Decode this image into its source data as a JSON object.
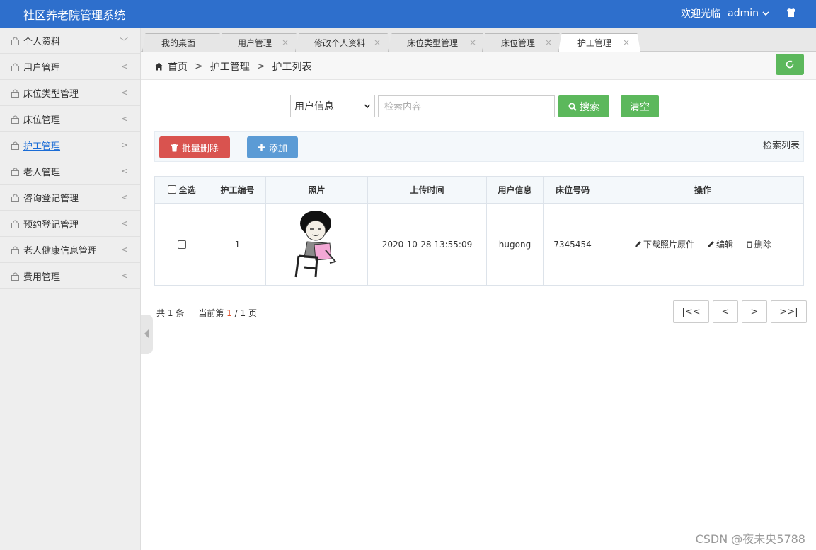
{
  "header": {
    "title": "社区养老院管理系统",
    "welcome": "欢迎光临",
    "username": "admin"
  },
  "sidebar": {
    "items": [
      {
        "label": "个人资料",
        "chevron": "﹀"
      },
      {
        "label": "用户管理",
        "chevron": "<"
      },
      {
        "label": "床位类型管理",
        "chevron": "<"
      },
      {
        "label": "床位管理",
        "chevron": "<"
      },
      {
        "label": "护工管理",
        "chevron": ">"
      },
      {
        "label": "老人管理",
        "chevron": "<"
      },
      {
        "label": "咨询登记管理",
        "chevron": "<"
      },
      {
        "label": "预约登记管理",
        "chevron": "<"
      },
      {
        "label": "老人健康信息管理",
        "chevron": "<"
      },
      {
        "label": "费用管理",
        "chevron": "<"
      }
    ]
  },
  "tabs": [
    {
      "label": "我的桌面",
      "close": ""
    },
    {
      "label": "用户管理",
      "close": "×"
    },
    {
      "label": "修改个人资料",
      "close": "×"
    },
    {
      "label": "床位类型管理",
      "close": "×"
    },
    {
      "label": "床位管理",
      "close": "×"
    },
    {
      "label": "护工管理",
      "close": "×"
    }
  ],
  "breadcrumb": {
    "home": "首页",
    "sep": ">",
    "level1": "护工管理",
    "level2": "护工列表"
  },
  "search": {
    "select_value": "用户信息",
    "placeholder": "检索内容",
    "search_label": "搜索",
    "clear_label": "清空"
  },
  "actions": {
    "batch_delete": "批量删除",
    "add": "添加",
    "list_title": "检索列表"
  },
  "table": {
    "headers": {
      "select_all": "全选",
      "id": "护工编号",
      "photo": "照片",
      "upload_time": "上传时间",
      "user_info": "用户信息",
      "bed_no": "床位号码",
      "ops": "操作"
    },
    "rows": [
      {
        "id": "1",
        "upload_time": "2020-10-28 13:55:09",
        "user_info": "hugong",
        "bed_no": "7345454",
        "download": "下载照片原件",
        "edit": "编辑",
        "delete": "删除"
      }
    ]
  },
  "pager": {
    "total_prefix": "共",
    "total": "1",
    "total_suffix": "条",
    "current_prefix": "当前第",
    "current": "1",
    "slash": "/",
    "pages": "1",
    "pages_suffix": "页",
    "first": "|<<",
    "prev": "<",
    "next": ">",
    "last": ">>|"
  },
  "watermark": "CSDN @夜未央5788",
  "colors": {
    "header_bg": "#2e6fcc",
    "success": "#5cb85c",
    "danger": "#d9534f",
    "primary": "#5b9bd5",
    "active_link": "#1a6cd6"
  }
}
